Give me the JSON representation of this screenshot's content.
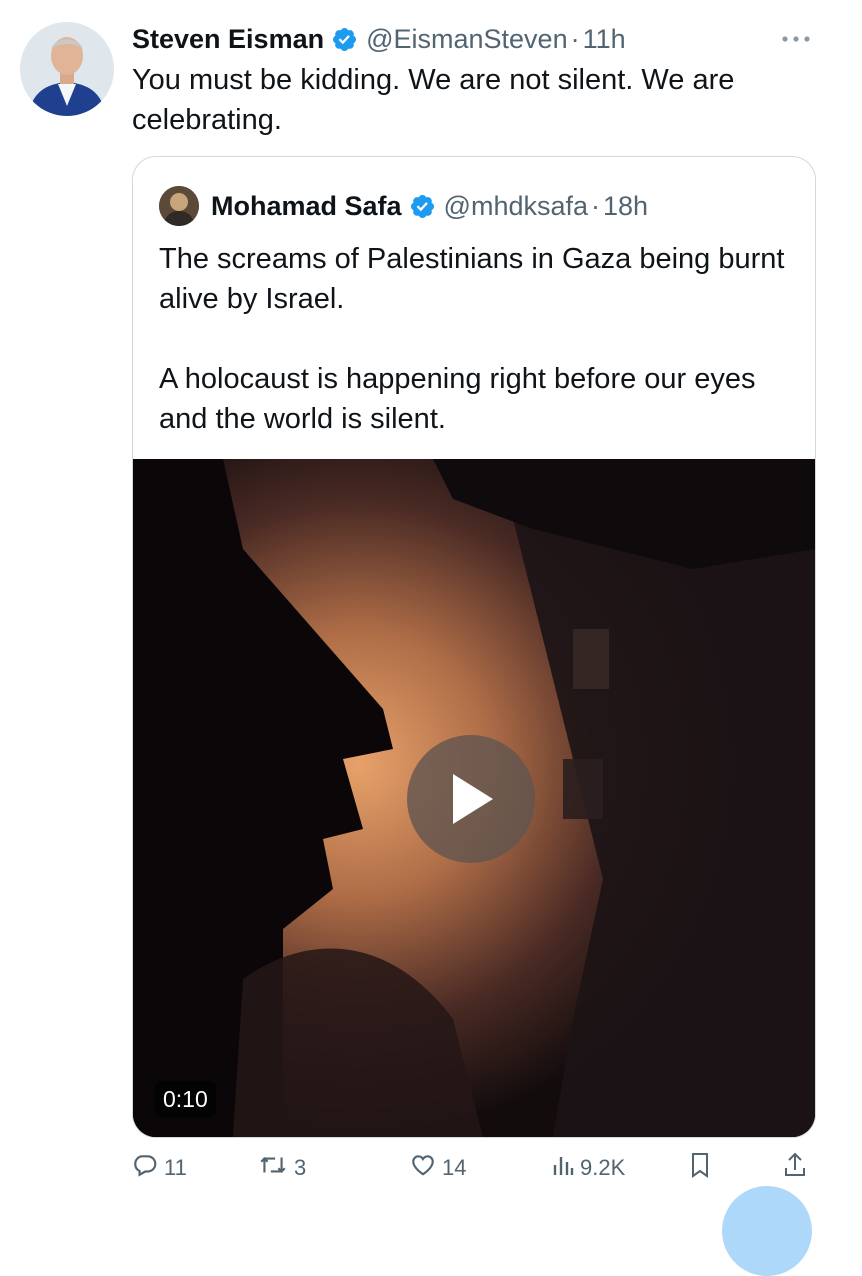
{
  "tweet": {
    "display_name": "Steven Eisman",
    "handle": "@EismanSteven",
    "separator": "·",
    "time": "11h",
    "text": "You must be kidding.  We are not silent. We are celebrating.",
    "verified_icon": "verified-badge-icon",
    "more_icon": "more-options-icon"
  },
  "quoted": {
    "display_name": "Mohamad Safa",
    "handle": "@mhdksafa",
    "separator": "·",
    "time": "18h",
    "paragraph_1": "The screams of Palestinians in Gaza being burnt alive by Israel.",
    "paragraph_2": "A holocaust is happening right before our eyes and the world is silent.",
    "video": {
      "duration": "0:10",
      "play_icon": "play-icon"
    }
  },
  "actions": {
    "replies": "11",
    "reposts": "3",
    "likes": "14",
    "views": "9.2K",
    "icons": [
      "reply-icon",
      "repost-icon",
      "like-icon",
      "views-icon",
      "bookmark-icon",
      "share-icon"
    ]
  },
  "colors": {
    "text_primary": "#0f1419",
    "text_secondary": "#536471",
    "verified_blue": "#1d9bf0",
    "border": "#cfd9de"
  }
}
